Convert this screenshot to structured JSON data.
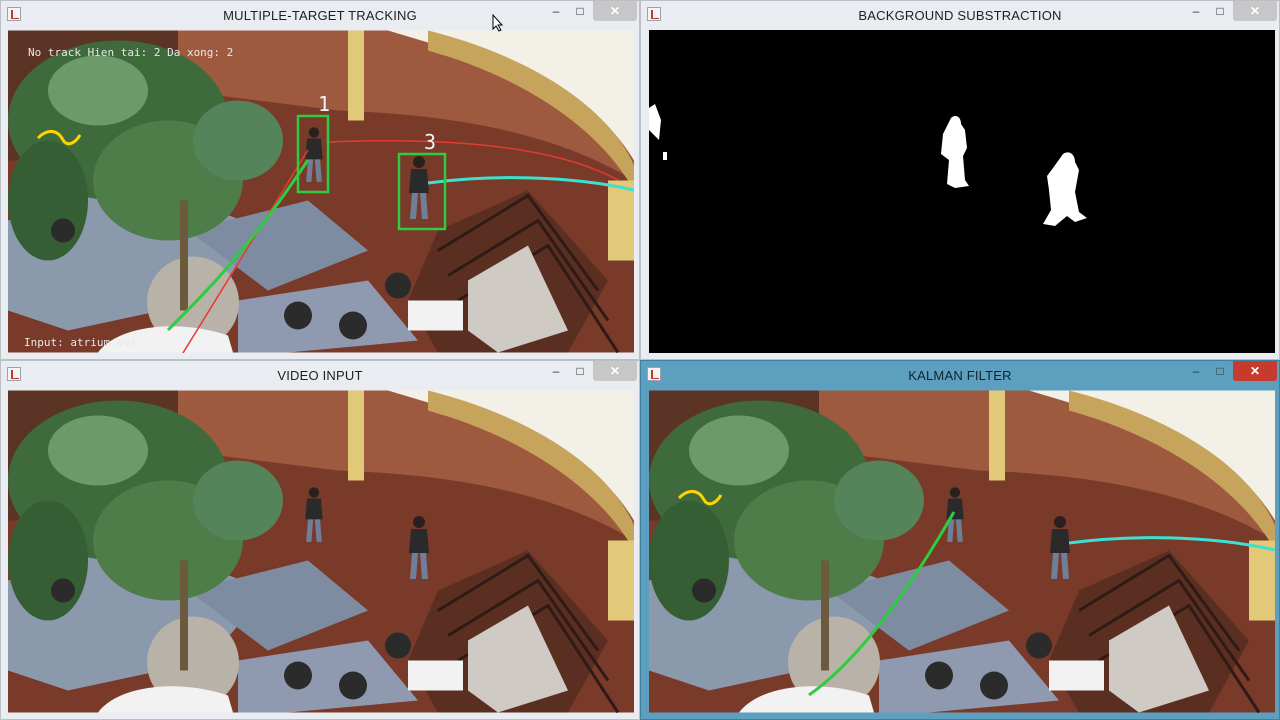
{
  "windows": {
    "tracking": {
      "title": "MULTIPLE-TARGET TRACKING",
      "overlay_top": "No track Hien tai: 2  Da xong: 2",
      "overlay_bottom": "Input: atrium.avi",
      "track_ids": [
        "1",
        "3"
      ]
    },
    "background": {
      "title": "BACKGROUND SUBSTRACTION"
    },
    "video": {
      "title": "VIDEO INPUT"
    },
    "kalman": {
      "title": "KALMAN FILTER"
    }
  },
  "controls": {
    "minimize": "–",
    "maximize": "□",
    "close": "✕"
  },
  "colors": {
    "active_title": "#5d9fbf",
    "inactive_title": "#e9ecf0",
    "close_active": "#c73b2f",
    "track_box": "#2ecc40",
    "track_red": "#e53935",
    "track_cyan": "#40e0d0",
    "track_yellow": "#ffd400"
  },
  "icons": {
    "window": "app-window-icon",
    "cursor": "mouse-cursor-icon"
  }
}
